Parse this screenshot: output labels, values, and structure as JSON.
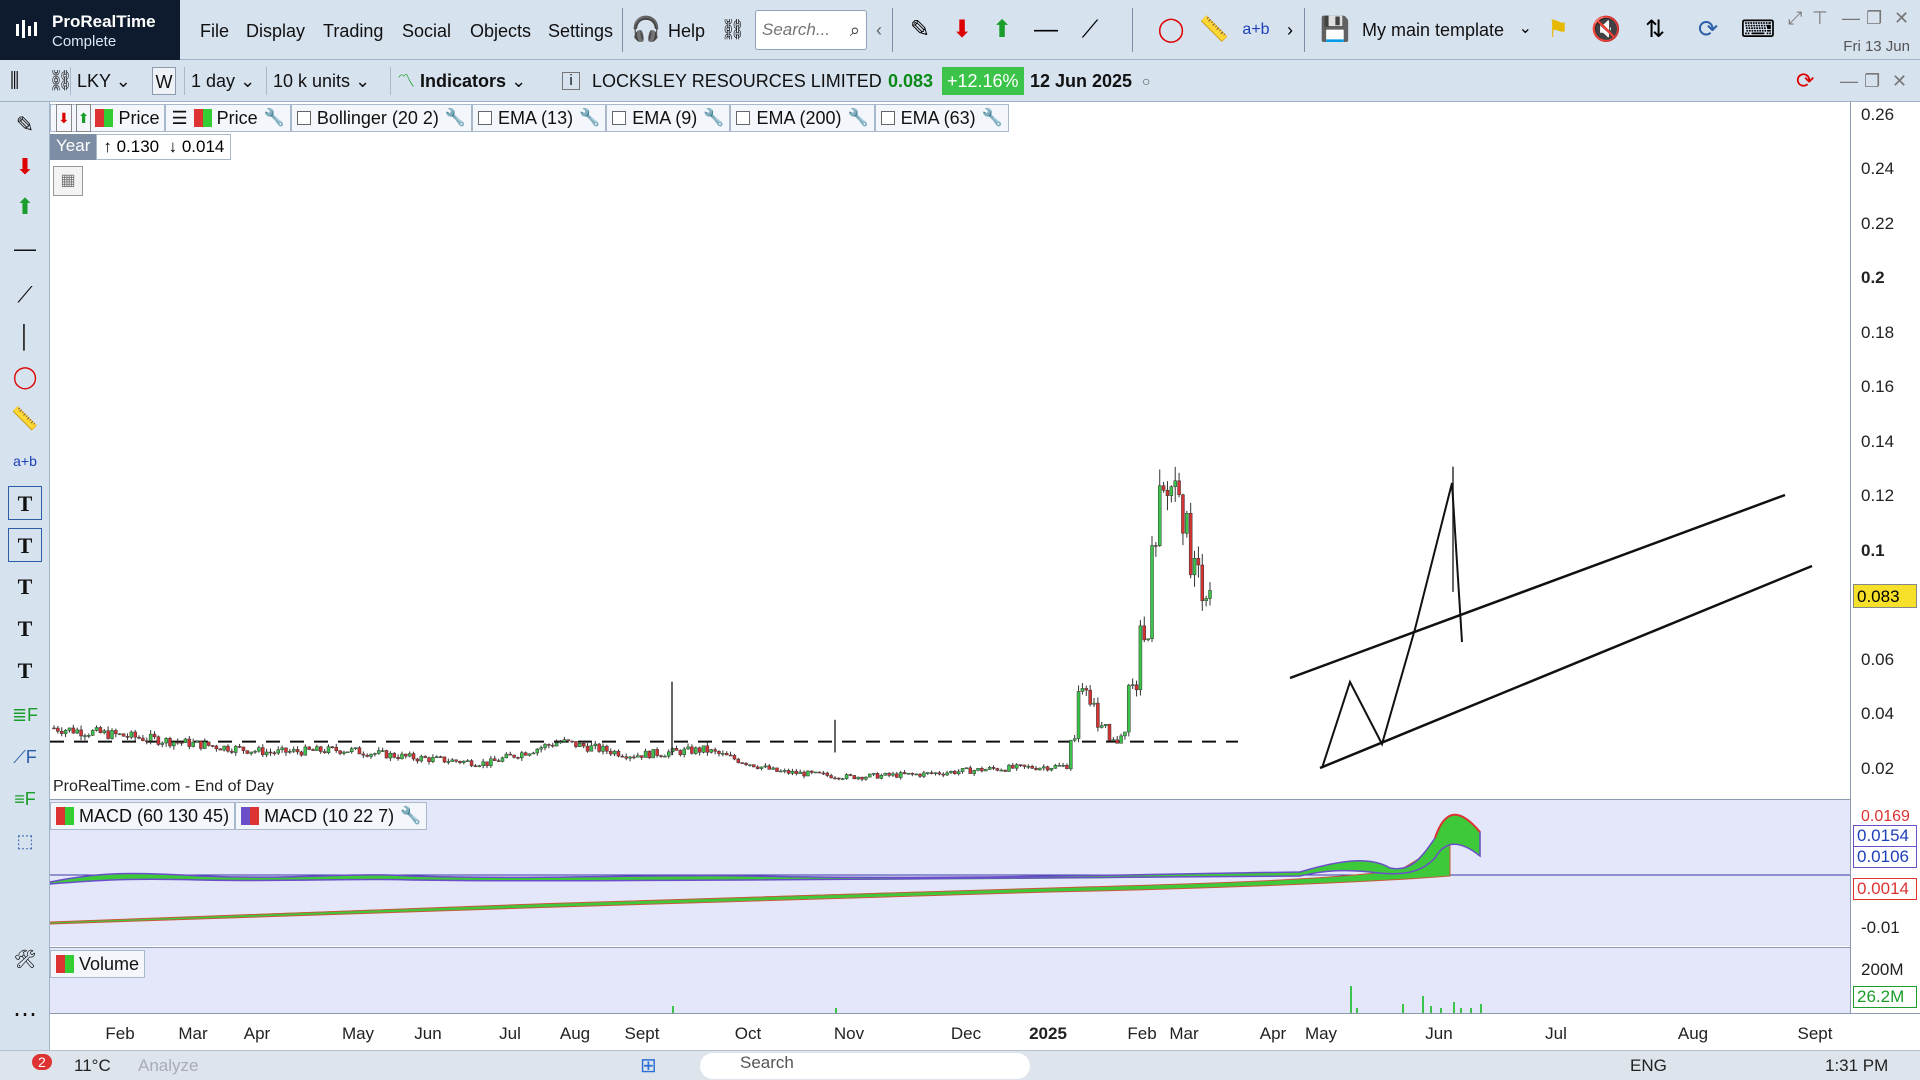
{
  "app": {
    "title": "ProRealTime",
    "subtitle": "Complete"
  },
  "menu": [
    "File",
    "Display",
    "Trading",
    "Social",
    "Objects",
    "Settings",
    "Help"
  ],
  "search": {
    "placeholder": "Search..."
  },
  "template": {
    "label": "My main template"
  },
  "datetime": "Fri 13 Jun",
  "toolbar": {
    "ticker": "LKY",
    "period_code": "W",
    "interval": "1 day",
    "units": "10 k units",
    "indicators_label": "Indicators",
    "instrument_name": "LOCKSLEY RESOURCES LIMITED",
    "last_price": "0.083",
    "change": "+12.16%",
    "date": "12 Jun 2025"
  },
  "indicators": {
    "price1": "Price",
    "price2": "Price",
    "bollinger": "Bollinger (20 2)",
    "ema13": "EMA (13)",
    "ema9": "EMA (9)",
    "ema200": "EMA (200)",
    "ema63": "EMA (63)",
    "macd1": "MACD (60 130 45)",
    "macd2": "MACD (10 22 7)",
    "volume": "Volume"
  },
  "year_box": {
    "label": "Year",
    "high": "0.130",
    "low": "0.014"
  },
  "source_label": "ProRealTime.com - End of Day",
  "y_axis": [
    "0.26",
    "0.24",
    "0.22",
    "0.2",
    "0.18",
    "0.16",
    "0.14",
    "0.12",
    "0.1",
    "0.083",
    "0.06",
    "0.04",
    "0.02"
  ],
  "macd_axis": {
    "v1": "0.0169",
    "v2": "0.0154",
    "v3": "0.0106",
    "v4": "0.0014",
    "v5": "-0.01"
  },
  "vol_axis": {
    "v1": "200M",
    "v2": "26.2M"
  },
  "x_axis": [
    "Feb",
    "Mar",
    "Apr",
    "May",
    "Jun",
    "Jul",
    "Aug",
    "Sept",
    "Oct",
    "Nov",
    "Dec",
    "2025",
    "Feb",
    "Mar",
    "Apr",
    "May",
    "Jun",
    "Jul",
    "Aug",
    "Sept"
  ],
  "taskbar": {
    "temp": "11°C",
    "search": "Search",
    "lang": "ENG",
    "time": "1:31 PM",
    "notif_count": "2",
    "analyze": "Analyze"
  },
  "colors": {
    "up": "#3cc34a",
    "down": "#d33333",
    "accent": "#2c5ea8",
    "macd_fill": "#3ec93a",
    "macd_signal": "#6a4fc9",
    "highlight_price": "#f7e02a"
  },
  "chart_data": {
    "type": "candlestick",
    "title": "LOCKSLEY RESOURCES LIMITED",
    "ylim": [
      0.01,
      0.265
    ],
    "series": [
      {
        "name": "Price",
        "x": [
          "Feb",
          "Mar",
          "Apr",
          "May",
          "Jun",
          "Jul",
          "Aug",
          "Sept",
          "Oct",
          "Nov",
          "Dec",
          "2025-Jan",
          "Feb",
          "Mar",
          "Apr",
          "May",
          "Jun"
        ],
        "values": [
          0.035,
          0.032,
          0.029,
          0.026,
          0.027,
          0.024,
          0.022,
          0.03,
          0.025,
          0.027,
          0.019,
          0.017,
          0.018,
          0.02,
          0.021,
          0.03,
          0.083
        ]
      }
    ],
    "year_high": 0.13,
    "year_low": 0.014,
    "last": 0.083
  }
}
